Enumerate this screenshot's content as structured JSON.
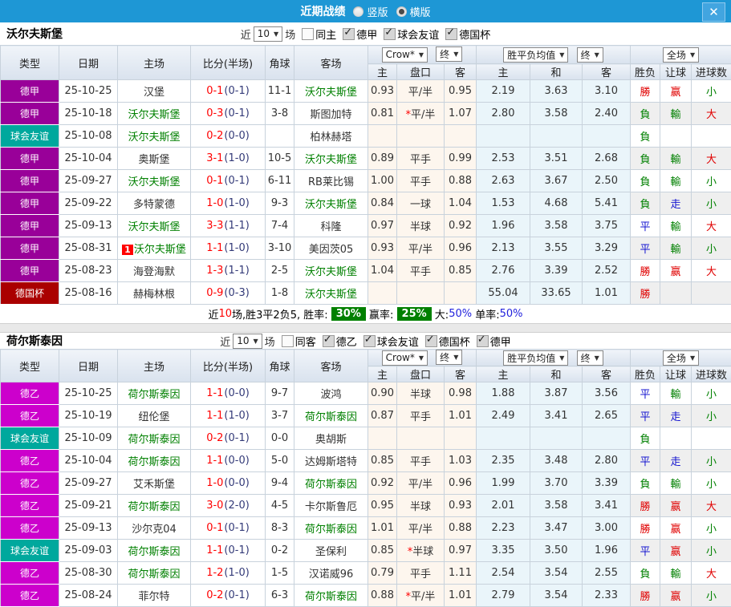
{
  "titlebar": {
    "title": "近期战绩",
    "radios": [
      {
        "label": "竖版",
        "selected": false
      },
      {
        "label": "横版",
        "selected": true
      }
    ],
    "close_label": "✕"
  },
  "filter_labels": {
    "near": "近",
    "games": "场"
  },
  "table_header": {
    "type": "类型",
    "date": "日期",
    "home": "主场",
    "score": "比分(半场)",
    "corner": "角球",
    "away": "客场",
    "odds_dropdown": "Crow*",
    "odds_final": "终",
    "avg_dropdown": "胜平负均值",
    "avg_final": "终",
    "fulltime_dropdown": "全场",
    "sub": {
      "home": "主",
      "handicap": "盘口",
      "away": "客",
      "avg_home": "主",
      "avg_draw": "和",
      "avg_away": "客",
      "result": "胜负",
      "handicap_result": "让球",
      "goals": "进球数"
    }
  },
  "colors": {
    "titlebar_blue": "#1e97d5",
    "league_dejia": "#990099",
    "league_deyi": "#cc00cc",
    "league_friendly": "#00a89d",
    "league_cup": "#aa0000",
    "focus_team_green": "#008000",
    "score_red": "#ff0000",
    "half_score_navy": "#333a78",
    "win_red": "#e00000",
    "lose_green": "#008000",
    "draw_blue": "#1515d0",
    "badge_green": "#008000",
    "percent_blue": "#2222dd"
  },
  "sections": [
    {
      "team": "沃尔夫斯堡",
      "match_count": "10",
      "same_venue_label": "同主",
      "same_checked": false,
      "leagues": [
        {
          "label": "德甲",
          "checked": true
        },
        {
          "label": "球会友谊",
          "checked": true
        },
        {
          "label": "德国杯",
          "checked": true
        }
      ],
      "rows": [
        {
          "league": "德甲",
          "league_key": "dejia",
          "date": "25-10-25",
          "home": "汉堡",
          "home_is_focus": false,
          "home_badge": "",
          "ft": "0-1",
          "ht": "(0-1)",
          "corner": "11-1",
          "away": "沃尔夫斯堡",
          "away_is_focus": true,
          "away_badge": "",
          "odds": [
            "0.93",
            "平/半",
            "0.95"
          ],
          "avg": [
            "2.19",
            "3.63",
            "3.10"
          ],
          "results": [
            [
              "勝",
              "win"
            ],
            [
              "赢",
              "win"
            ],
            [
              "小",
              "lose"
            ]
          ]
        },
        {
          "league": "德甲",
          "league_key": "dejia",
          "date": "25-10-18",
          "home": "沃尔夫斯堡",
          "home_is_focus": true,
          "home_badge": "",
          "ft": "0-3",
          "ht": "(0-1)",
          "corner": "3-8",
          "away": "斯图加特",
          "away_is_focus": false,
          "away_badge": "",
          "odds": [
            "0.81",
            "*平/半",
            "1.07"
          ],
          "avg": [
            "2.80",
            "3.58",
            "2.40"
          ],
          "results": [
            [
              "負",
              "lose"
            ],
            [
              "輸",
              "lose"
            ],
            [
              "大",
              "win"
            ]
          ]
        },
        {
          "league": "球会友谊",
          "league_key": "friendly",
          "date": "25-10-08",
          "home": "沃尔夫斯堡",
          "home_is_focus": true,
          "home_badge": "",
          "ft": "0-2",
          "ht": "(0-0)",
          "corner": "",
          "away": "柏林赫塔",
          "away_is_focus": false,
          "away_badge": "",
          "odds": [
            "",
            "",
            ""
          ],
          "avg": [
            "",
            "",
            ""
          ],
          "results": [
            [
              "負",
              "lose"
            ],
            [
              "",
              ""
            ],
            [
              "",
              ""
            ]
          ]
        },
        {
          "league": "德甲",
          "league_key": "dejia",
          "date": "25-10-04",
          "home": "奥斯堡",
          "home_is_focus": false,
          "home_badge": "",
          "ft": "3-1",
          "ht": "(1-0)",
          "corner": "10-5",
          "away": "沃尔夫斯堡",
          "away_is_focus": true,
          "away_badge": "",
          "odds": [
            "0.89",
            "平手",
            "0.99"
          ],
          "avg": [
            "2.53",
            "3.51",
            "2.68"
          ],
          "results": [
            [
              "負",
              "lose"
            ],
            [
              "輸",
              "lose"
            ],
            [
              "大",
              "win"
            ]
          ]
        },
        {
          "league": "德甲",
          "league_key": "dejia",
          "date": "25-09-27",
          "home": "沃尔夫斯堡",
          "home_is_focus": true,
          "home_badge": "",
          "ft": "0-1",
          "ht": "(0-1)",
          "corner": "6-11",
          "away": "RB莱比锡",
          "away_is_focus": false,
          "away_badge": "",
          "odds": [
            "1.00",
            "平手",
            "0.88"
          ],
          "avg": [
            "2.63",
            "3.67",
            "2.50"
          ],
          "results": [
            [
              "負",
              "lose"
            ],
            [
              "輸",
              "lose"
            ],
            [
              "小",
              "lose"
            ]
          ]
        },
        {
          "league": "德甲",
          "league_key": "dejia",
          "date": "25-09-22",
          "home": "多特蒙德",
          "home_is_focus": false,
          "home_badge": "",
          "ft": "1-0",
          "ht": "(1-0)",
          "corner": "9-3",
          "away": "沃尔夫斯堡",
          "away_is_focus": true,
          "away_badge": "",
          "odds": [
            "0.84",
            "一球",
            "1.04"
          ],
          "avg": [
            "1.53",
            "4.68",
            "5.41"
          ],
          "results": [
            [
              "負",
              "lose"
            ],
            [
              "走",
              "draw"
            ],
            [
              "小",
              "lose"
            ]
          ]
        },
        {
          "league": "德甲",
          "league_key": "dejia",
          "date": "25-09-13",
          "home": "沃尔夫斯堡",
          "home_is_focus": true,
          "home_badge": "",
          "ft": "3-3",
          "ht": "(1-1)",
          "corner": "7-4",
          "away": "科隆",
          "away_is_focus": false,
          "away_badge": "",
          "odds": [
            "0.97",
            "半球",
            "0.92"
          ],
          "avg": [
            "1.96",
            "3.58",
            "3.75"
          ],
          "results": [
            [
              "平",
              "draw"
            ],
            [
              "輸",
              "lose"
            ],
            [
              "大",
              "win"
            ]
          ]
        },
        {
          "league": "德甲",
          "league_key": "dejia",
          "date": "25-08-31",
          "home": "沃尔夫斯堡",
          "home_is_focus": true,
          "home_badge": "1",
          "ft": "1-1",
          "ht": "(1-0)",
          "corner": "3-10",
          "away": "美因茨05",
          "away_is_focus": false,
          "away_badge": "",
          "odds": [
            "0.93",
            "平/半",
            "0.96"
          ],
          "avg": [
            "2.13",
            "3.55",
            "3.29"
          ],
          "results": [
            [
              "平",
              "draw"
            ],
            [
              "輸",
              "lose"
            ],
            [
              "小",
              "lose"
            ]
          ]
        },
        {
          "league": "德甲",
          "league_key": "dejia",
          "date": "25-08-23",
          "home": "海登海默",
          "home_is_focus": false,
          "home_badge": "",
          "ft": "1-3",
          "ht": "(1-1)",
          "corner": "2-5",
          "away": "沃尔夫斯堡",
          "away_is_focus": true,
          "away_badge": "",
          "odds": [
            "1.04",
            "平手",
            "0.85"
          ],
          "avg": [
            "2.76",
            "3.39",
            "2.52"
          ],
          "results": [
            [
              "勝",
              "win"
            ],
            [
              "赢",
              "win"
            ],
            [
              "大",
              "win"
            ]
          ]
        },
        {
          "league": "德国杯",
          "league_key": "cup",
          "date": "25-08-16",
          "home": "赫梅林根",
          "home_is_focus": false,
          "home_badge": "",
          "ft": "0-9",
          "ht": "(0-3)",
          "corner": "1-8",
          "away": "沃尔夫斯堡",
          "away_is_focus": true,
          "away_badge": "",
          "odds": [
            "",
            "",
            ""
          ],
          "avg": [
            "55.04",
            "33.65",
            "1.01"
          ],
          "results": [
            [
              "勝",
              "win"
            ],
            [
              "",
              ""
            ],
            [
              "",
              ""
            ]
          ]
        }
      ],
      "summary": [
        {
          "text": "近",
          "style": "plain"
        },
        {
          "text": "10",
          "style": "red"
        },
        {
          "text": "场,胜3平2负5, 胜率: ",
          "style": "plain"
        },
        {
          "text": "30%",
          "style": "badge"
        },
        {
          "text": " 赢率: ",
          "style": "plain"
        },
        {
          "text": "25%",
          "style": "badge"
        },
        {
          "text": " 大:",
          "style": "plain"
        },
        {
          "text": "50%",
          "style": "blue"
        },
        {
          "text": " 单率:",
          "style": "plain"
        },
        {
          "text": "50%",
          "style": "blue"
        }
      ]
    },
    {
      "team": "荷尔斯泰因",
      "match_count": "10",
      "same_venue_label": "同客",
      "same_checked": false,
      "leagues": [
        {
          "label": "德乙",
          "checked": true
        },
        {
          "label": "球会友谊",
          "checked": true
        },
        {
          "label": "德国杯",
          "checked": true
        },
        {
          "label": "德甲",
          "checked": true
        }
      ],
      "rows": [
        {
          "league": "德乙",
          "league_key": "deyi",
          "date": "25-10-25",
          "home": "荷尔斯泰因",
          "home_is_focus": true,
          "home_badge": "",
          "ft": "1-1",
          "ht": "(0-0)",
          "corner": "9-7",
          "away": "波鸿",
          "away_is_focus": false,
          "away_badge": "",
          "odds": [
            "0.90",
            "半球",
            "0.98"
          ],
          "avg": [
            "1.88",
            "3.87",
            "3.56"
          ],
          "results": [
            [
              "平",
              "draw"
            ],
            [
              "輸",
              "lose"
            ],
            [
              "小",
              "lose"
            ]
          ]
        },
        {
          "league": "德乙",
          "league_key": "deyi",
          "date": "25-10-19",
          "home": "纽伦堡",
          "home_is_focus": false,
          "home_badge": "",
          "ft": "1-1",
          "ht": "(1-0)",
          "corner": "3-7",
          "away": "荷尔斯泰因",
          "away_is_focus": true,
          "away_badge": "",
          "odds": [
            "0.87",
            "平手",
            "1.01"
          ],
          "avg": [
            "2.49",
            "3.41",
            "2.65"
          ],
          "results": [
            [
              "平",
              "draw"
            ],
            [
              "走",
              "draw"
            ],
            [
              "小",
              "lose"
            ]
          ]
        },
        {
          "league": "球会友谊",
          "league_key": "friendly",
          "date": "25-10-09",
          "home": "荷尔斯泰因",
          "home_is_focus": true,
          "home_badge": "",
          "ft": "0-2",
          "ht": "(0-1)",
          "corner": "0-0",
          "away": "奥胡斯",
          "away_is_focus": false,
          "away_badge": "",
          "odds": [
            "",
            "",
            ""
          ],
          "avg": [
            "",
            "",
            ""
          ],
          "results": [
            [
              "負",
              "lose"
            ],
            [
              "",
              ""
            ],
            [
              "",
              ""
            ]
          ]
        },
        {
          "league": "德乙",
          "league_key": "deyi",
          "date": "25-10-04",
          "home": "荷尔斯泰因",
          "home_is_focus": true,
          "home_badge": "",
          "ft": "1-1",
          "ht": "(0-0)",
          "corner": "5-0",
          "away": "达姆斯塔特",
          "away_is_focus": false,
          "away_badge": "",
          "odds": [
            "0.85",
            "平手",
            "1.03"
          ],
          "avg": [
            "2.35",
            "3.48",
            "2.80"
          ],
          "results": [
            [
              "平",
              "draw"
            ],
            [
              "走",
              "draw"
            ],
            [
              "小",
              "lose"
            ]
          ]
        },
        {
          "league": "德乙",
          "league_key": "deyi",
          "date": "25-09-27",
          "home": "艾禾斯堡",
          "home_is_focus": false,
          "home_badge": "",
          "ft": "1-0",
          "ht": "(0-0)",
          "corner": "9-4",
          "away": "荷尔斯泰因",
          "away_is_focus": true,
          "away_badge": "",
          "odds": [
            "0.92",
            "平/半",
            "0.96"
          ],
          "avg": [
            "1.99",
            "3.70",
            "3.39"
          ],
          "results": [
            [
              "負",
              "lose"
            ],
            [
              "輸",
              "lose"
            ],
            [
              "小",
              "lose"
            ]
          ]
        },
        {
          "league": "德乙",
          "league_key": "deyi",
          "date": "25-09-21",
          "home": "荷尔斯泰因",
          "home_is_focus": true,
          "home_badge": "",
          "ft": "3-0",
          "ht": "(2-0)",
          "corner": "4-5",
          "away": "卡尔斯鲁厄",
          "away_is_focus": false,
          "away_badge": "",
          "odds": [
            "0.95",
            "半球",
            "0.93"
          ],
          "avg": [
            "2.01",
            "3.58",
            "3.41"
          ],
          "results": [
            [
              "勝",
              "win"
            ],
            [
              "赢",
              "win"
            ],
            [
              "大",
              "win"
            ]
          ]
        },
        {
          "league": "德乙",
          "league_key": "deyi",
          "date": "25-09-13",
          "home": "沙尔克04",
          "home_is_focus": false,
          "home_badge": "",
          "ft": "0-1",
          "ht": "(0-1)",
          "corner": "8-3",
          "away": "荷尔斯泰因",
          "away_is_focus": true,
          "away_badge": "",
          "odds": [
            "1.01",
            "平/半",
            "0.88"
          ],
          "avg": [
            "2.23",
            "3.47",
            "3.00"
          ],
          "results": [
            [
              "勝",
              "win"
            ],
            [
              "赢",
              "win"
            ],
            [
              "小",
              "lose"
            ]
          ]
        },
        {
          "league": "球会友谊",
          "league_key": "friendly",
          "date": "25-09-03",
          "home": "荷尔斯泰因",
          "home_is_focus": true,
          "home_badge": "",
          "ft": "1-1",
          "ht": "(0-1)",
          "corner": "0-2",
          "away": "圣保利",
          "away_is_focus": false,
          "away_badge": "",
          "odds": [
            "0.85",
            "*半球",
            "0.97"
          ],
          "avg": [
            "3.35",
            "3.50",
            "1.96"
          ],
          "results": [
            [
              "平",
              "draw"
            ],
            [
              "赢",
              "win"
            ],
            [
              "小",
              "lose"
            ]
          ]
        },
        {
          "league": "德乙",
          "league_key": "deyi",
          "date": "25-08-30",
          "home": "荷尔斯泰因",
          "home_is_focus": true,
          "home_badge": "",
          "ft": "1-2",
          "ht": "(1-0)",
          "corner": "1-5",
          "away": "汉诺威96",
          "away_is_focus": false,
          "away_badge": "",
          "odds": [
            "0.79",
            "平手",
            "1.11"
          ],
          "avg": [
            "2.54",
            "3.54",
            "2.55"
          ],
          "results": [
            [
              "負",
              "lose"
            ],
            [
              "輸",
              "lose"
            ],
            [
              "大",
              "win"
            ]
          ]
        },
        {
          "league": "德乙",
          "league_key": "deyi",
          "date": "25-08-24",
          "home": "菲尔特",
          "home_is_focus": false,
          "home_badge": "",
          "ft": "0-2",
          "ht": "(0-1)",
          "corner": "6-3",
          "away": "荷尔斯泰因",
          "away_is_focus": true,
          "away_badge": "",
          "odds": [
            "0.88",
            "*平/半",
            "1.01"
          ],
          "avg": [
            "2.79",
            "3.54",
            "2.33"
          ],
          "results": [
            [
              "勝",
              "win"
            ],
            [
              "赢",
              "win"
            ],
            [
              "小",
              "lose"
            ]
          ]
        }
      ],
      "summary": []
    }
  ]
}
